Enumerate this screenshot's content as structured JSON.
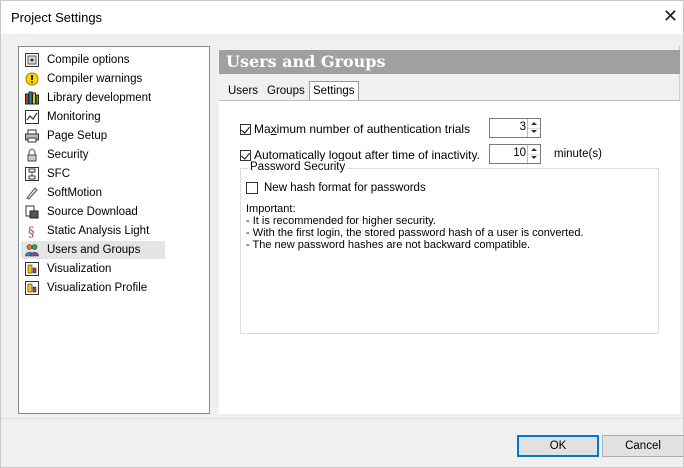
{
  "window": {
    "title": "Project Settings",
    "close_glyph": "✕"
  },
  "tree": {
    "items": [
      {
        "label": "Compile options",
        "icon": "compile-icon"
      },
      {
        "label": "Compiler warnings",
        "icon": "warning-icon"
      },
      {
        "label": "Library development",
        "icon": "library-icon"
      },
      {
        "label": "Monitoring",
        "icon": "monitoring-icon"
      },
      {
        "label": "Page Setup",
        "icon": "printer-icon"
      },
      {
        "label": "Security",
        "icon": "security-icon"
      },
      {
        "label": "SFC",
        "icon": "sfc-icon"
      },
      {
        "label": "SoftMotion",
        "icon": "softmotion-icon"
      },
      {
        "label": "Source Download",
        "icon": "download-icon"
      },
      {
        "label": "Static Analysis Light",
        "icon": "static-analysis-icon"
      },
      {
        "label": "Users and Groups",
        "icon": "users-icon",
        "selected": true
      },
      {
        "label": "Visualization",
        "icon": "visualization-icon"
      },
      {
        "label": "Visualization Profile",
        "icon": "visualization-profile-icon"
      }
    ]
  },
  "panel": {
    "title": "Users and Groups",
    "tabs": [
      {
        "label": "Users"
      },
      {
        "label": "Groups"
      },
      {
        "label": "Settings",
        "active": true
      }
    ],
    "settings": {
      "max_trials_label_pre": "Ma",
      "max_trials_label_u": "x",
      "max_trials_label_post": "imum number of authentication trials",
      "max_trials_checked": true,
      "max_trials_value": "3",
      "logout_label_pre": "Automatically lo",
      "logout_label_u": "g",
      "logout_label_post": "out after time of inactivity.",
      "logout_checked": true,
      "logout_value": "10",
      "logout_unit": "minute(s)",
      "password_group_title": "Password Security",
      "hash_label": "New hash format for passwords",
      "hash_checked": false,
      "note_lines": [
        "Important:",
        "- It is recommended for higher security.",
        "- With the first login, the stored password hash of a user is converted.",
        "- The new password hashes are not backward compatible."
      ]
    }
  },
  "buttons": {
    "ok": "OK",
    "cancel": "Cancel"
  }
}
